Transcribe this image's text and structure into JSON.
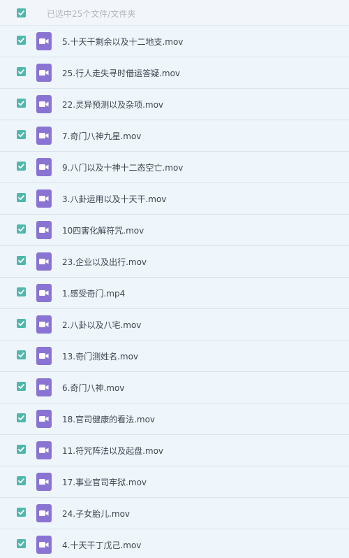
{
  "header": {
    "select_all_text": "已选中25个文件/文件夹"
  },
  "colors": {
    "checkbox": "#4fb7ac",
    "video_icon": "#8a74d3",
    "row_background": "#eef5fb"
  },
  "files": [
    {
      "name": "5.十天干剩余以及十二地支.mov",
      "checked": true,
      "icon": "video-file-icon"
    },
    {
      "name": "25.行人走失寻时借运答疑.mov",
      "checked": true,
      "icon": "video-file-icon"
    },
    {
      "name": "22.灵异预测以及杂项.mov",
      "checked": true,
      "icon": "video-file-icon"
    },
    {
      "name": "7.奇门八神九星.mov",
      "checked": true,
      "icon": "video-file-icon"
    },
    {
      "name": "9.八门以及十神十二态空亡.mov",
      "checked": true,
      "icon": "video-file-icon"
    },
    {
      "name": "3.八卦运用以及十天干.mov",
      "checked": true,
      "icon": "video-file-icon"
    },
    {
      "name": "10四害化解符咒.mov",
      "checked": true,
      "icon": "video-file-icon"
    },
    {
      "name": "23.企业以及出行.mov",
      "checked": true,
      "icon": "video-file-icon"
    },
    {
      "name": "1.感受奇门.mp4",
      "checked": true,
      "icon": "video-file-icon"
    },
    {
      "name": "2.八卦以及八宅.mov",
      "checked": true,
      "icon": "video-file-icon"
    },
    {
      "name": "13.奇门测姓名.mov",
      "checked": true,
      "icon": "video-file-icon"
    },
    {
      "name": "6.奇门八神.mov",
      "checked": true,
      "icon": "video-file-icon"
    },
    {
      "name": "18.官司健康的看法.mov",
      "checked": true,
      "icon": "video-file-icon"
    },
    {
      "name": "11.符咒阵法以及起盘.mov",
      "checked": true,
      "icon": "video-file-icon"
    },
    {
      "name": "17.事业官司牢狱.mov",
      "checked": true,
      "icon": "video-file-icon"
    },
    {
      "name": "24.子女胎儿.mov",
      "checked": true,
      "icon": "video-file-icon"
    },
    {
      "name": "4.十天干丁戊己.mov",
      "checked": true,
      "icon": "video-file-icon"
    }
  ]
}
